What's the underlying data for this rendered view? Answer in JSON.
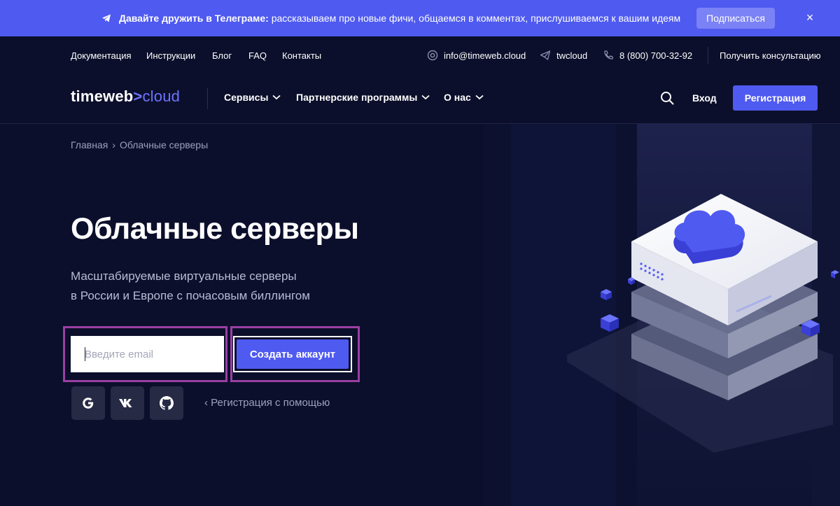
{
  "promo": {
    "bold": "Давайте дружить в Телеграме:",
    "text": " рассказываем про новые фичи, общаемся в комментах, прислушиваемся к вашим идеям",
    "subscribe_label": "Подписаться",
    "close_label": "×"
  },
  "toplinks": {
    "items": [
      "Документация",
      "Инструкции",
      "Блог",
      "FAQ",
      "Контакты"
    ],
    "email": "info@timeweb.cloud",
    "telegram": "twcloud",
    "phone": "8 (800) 700-32-92",
    "consult": "Получить консультацию"
  },
  "nav": {
    "logo_main": "timeweb",
    "logo_arrow": ">",
    "logo_cloud": "cloud",
    "items": [
      "Сервисы",
      "Партнерские программы",
      "О нас"
    ],
    "login": "Вход",
    "register": "Регистрация"
  },
  "hero": {
    "breadcrumb_home": "Главная",
    "breadcrumb_sep": "›",
    "breadcrumb_current": "Облачные серверы",
    "title": "Облачные серверы",
    "subtitle_line1": "Масштабируемые виртуальные серверы",
    "subtitle_line2": "в России и Европе с почасовым биллингом",
    "email_placeholder": "Введите email",
    "create_label": "Создать аккаунт",
    "social": [
      "G",
      "VK",
      "GitHub"
    ],
    "reg_via": "‹  Регистрация с помощью"
  },
  "colors": {
    "background": "#0c0f2b",
    "accent": "#4f5af0",
    "highlight_border": "#9a3fa3"
  }
}
